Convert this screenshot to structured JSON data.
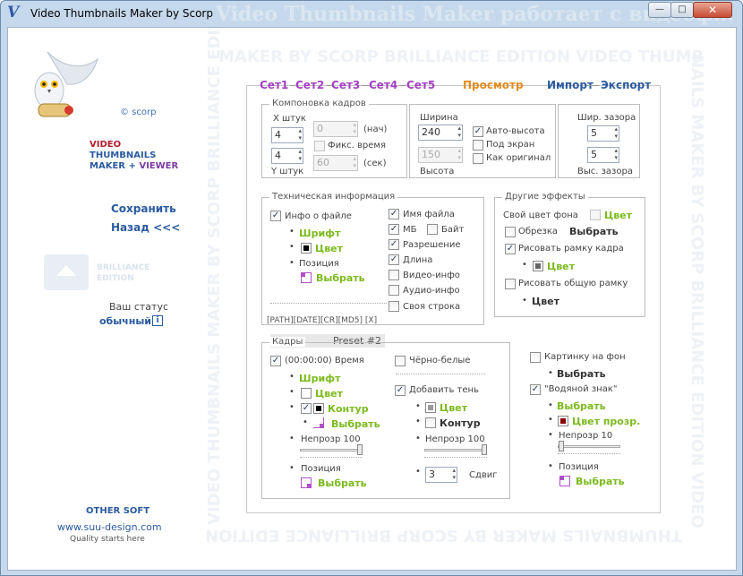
{
  "window": {
    "title": "Video Thumbnails Maker by Scorp",
    "title_bg": "Video Thumbnails Maker работает с видеоф...",
    "minimize": "—",
    "maximize": "□",
    "close": "✕"
  },
  "watermark": {
    "top": "MAKER BY SCORP BRILLIANCE EDITION VIDEO THUMB",
    "right": "NAILS MAKER BY SCORP BRILLIANCE EDITION VIDEO",
    "bottom": "THUMBNAILS MAKER BY SCORP BRILLIANCE EDITION",
    "left": "VIDEO THUMBNAILS MAKER BY SCORP BRILLIANCE EDITION VIDEO THUMBNAILS M"
  },
  "sidebar": {
    "copyright": "© scorp",
    "product": {
      "line1": "VIDEO",
      "line2": "THUMBNAILS",
      "line3a": "MAKER",
      "line3b": "+",
      "line3c": "VIEWER"
    },
    "save": "Сохранить",
    "back": "Назад <<<",
    "brilliance": "BRILLIANCE",
    "edition": "EDITION",
    "status_label": "Ваш статус",
    "status_value": "обычный",
    "info": "i",
    "other_soft": "OTHER SOFT",
    "site": "www.suu-design.com",
    "quality": "Quality starts here"
  },
  "tabs": [
    {
      "label": "Сет1"
    },
    {
      "label": "Сет2"
    },
    {
      "label": "Сет3"
    },
    {
      "label": "Сет4"
    },
    {
      "label": "Сет5"
    },
    {
      "label": "Просмотр"
    },
    {
      "label": "Импорт"
    },
    {
      "label": "Экспорт"
    }
  ],
  "layout_group": {
    "title": "Компоновка кадров",
    "x_label": "X штук",
    "y_label": "Y штук",
    "x_value": "4",
    "y_value": "4",
    "start_value": "0",
    "start_label": "(нач)",
    "fixed_time": "Фикс. время",
    "sec_value": "60",
    "sec_label": "(сек)"
  },
  "size_group": {
    "width_label": "Ширина",
    "width_value": "240",
    "height_value": "150",
    "height_label": "Высота",
    "auto_height": "Авто-высота",
    "fit_screen": "Под экран",
    "as_original": "Как оригинал"
  },
  "gap_group": {
    "width_label": "Шир. зазора",
    "width_value": "5",
    "height_value": "5",
    "height_label": "Выс. зазора"
  },
  "tech_group": {
    "title": "Техническая  информация",
    "file_info": "Инфо о файле",
    "font": "Шрифт",
    "color": "Цвет",
    "position": "Позиция",
    "choose": "Выбрать",
    "tags": "[PATH][DATE][CR][MD5] [X]",
    "preset": "Preset #2",
    "file_name": "Имя файла",
    "mb": "МБ",
    "byte": "Байт",
    "resolution": "Разрешение",
    "length": "Длина",
    "video_info": "Видео-инфо",
    "audio_info": "Аудио-инфо",
    "own_line": "Своя строка"
  },
  "effects_group": {
    "title": "Другие эффекты",
    "bg_color": "Свой цвет фона",
    "color": "Цвет",
    "crop": "Обрезка",
    "choose": "Выбрать",
    "frame_border": "Рисовать рамку кадра",
    "border_color": "Цвет",
    "common_border": "Рисовать общую рамку",
    "common_color": "Цвет"
  },
  "frames_group": {
    "title": "Кадры",
    "time": "(00:00:00) Время",
    "font": "Шрифт",
    "color": "Цвет",
    "outline": "Контур",
    "choose": "Выбрать",
    "opacity": "Непрозр 100",
    "position": "Позиция",
    "choose2": "Выбрать",
    "bw": "Чёрно-белые",
    "add_shadow": "Добавить тень",
    "shadow_color": "Цвет",
    "shadow_outline": "Контур",
    "shadow_opacity": "Непрозр 100",
    "shift_value": "3",
    "shift_label": "Сдвиг"
  },
  "bg_group": {
    "bg_image": "Картинку на фон",
    "choose": "Выбрать",
    "watermark": "\"Водяной знак\"",
    "wm_choose": "Выбрать",
    "transparent_color": "Цвет прозр.",
    "opacity": "Непрозр 10",
    "position": "Позиция",
    "pos_choose": "Выбрать"
  },
  "colors": {
    "accent_green": "#7cba1d",
    "link_blue": "#2a5aa0",
    "tab_purple": "#a43fc5",
    "tab_orange": "#e7891b",
    "transparent_swatch": "#8b0000"
  }
}
